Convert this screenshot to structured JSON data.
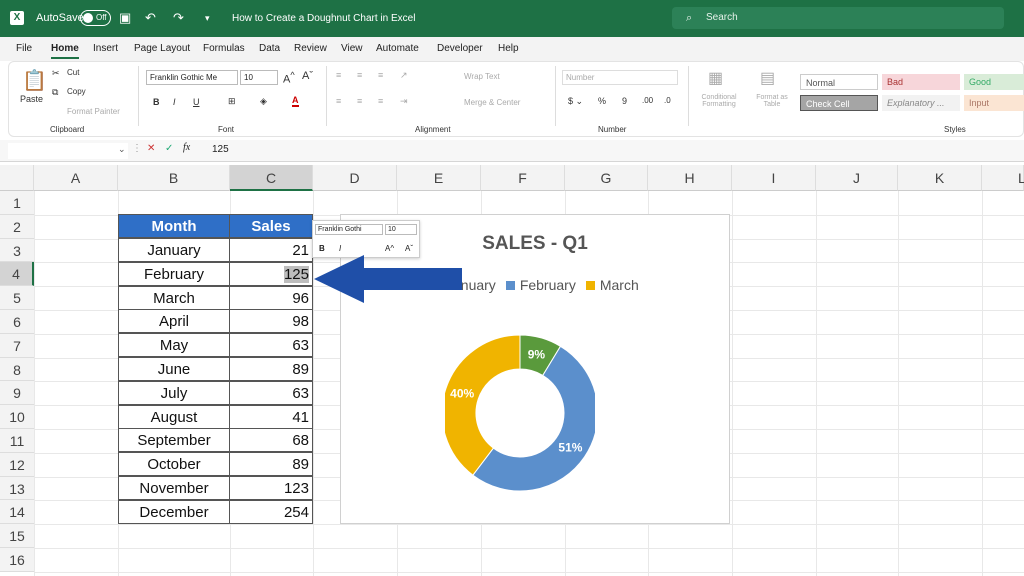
{
  "titlebar": {
    "autosave": "AutoSave",
    "toggle": "Off",
    "doc_title": "How to Create a Doughnut Chart in Excel",
    "search_placeholder": "Search"
  },
  "menu": [
    "File",
    "Home",
    "Insert",
    "Page Layout",
    "Formulas",
    "Data",
    "Review",
    "View",
    "Automate",
    "Developer",
    "Help"
  ],
  "ribbon": {
    "paste": "Paste",
    "cut": "Cut",
    "copy": "Copy",
    "format_painter": "Format Painter",
    "clipboard": "Clipboard",
    "font_name": "Franklin Gothic Me",
    "font_size": "10",
    "font": "Font",
    "wrap_text": "Wrap Text",
    "merge_center": "Merge & Center",
    "alignment": "Alignment",
    "number_format": "Number",
    "number": "Number",
    "conditional": "Conditional Formatting",
    "format_as_table": "Format as Table",
    "styles_label": "Styles",
    "styles": [
      "Normal",
      "Bad",
      "Good",
      "Check Cell",
      "Explanatory ...",
      "Input"
    ]
  },
  "formula_bar": {
    "value": "125",
    "fx": "fx"
  },
  "columns": [
    "A",
    "B",
    "C",
    "D",
    "E",
    "F",
    "G",
    "H",
    "I",
    "J",
    "K",
    "L"
  ],
  "rows": [
    "1",
    "2",
    "3",
    "4",
    "5",
    "6",
    "7",
    "8",
    "9",
    "10",
    "11",
    "12",
    "13",
    "14",
    "15",
    "16"
  ],
  "table": {
    "headers": [
      "Month",
      "Sales"
    ],
    "rows": [
      [
        "January",
        "21"
      ],
      [
        "February",
        "125"
      ],
      [
        "March",
        "96"
      ],
      [
        "April",
        "98"
      ],
      [
        "May",
        "63"
      ],
      [
        "June",
        "89"
      ],
      [
        "July",
        "63"
      ],
      [
        "August",
        "41"
      ],
      [
        "September",
        "68"
      ],
      [
        "October",
        "89"
      ],
      [
        "November",
        "123"
      ],
      [
        "December",
        "254"
      ]
    ]
  },
  "mini_toolbar": {
    "font": "Franklin Gothi",
    "size": "10"
  },
  "chart_data": {
    "type": "pie",
    "title": "SALES - Q1",
    "categories": [
      "January",
      "February",
      "March"
    ],
    "values": [
      21,
      125,
      96
    ],
    "labels": [
      "9%",
      "51%",
      "40%"
    ],
    "colors": [
      "#5a9a3c",
      "#5b8fcc",
      "#f0b400"
    ],
    "legend_position": "top",
    "legend_visible": [
      "anuary",
      "February",
      "March"
    ]
  }
}
